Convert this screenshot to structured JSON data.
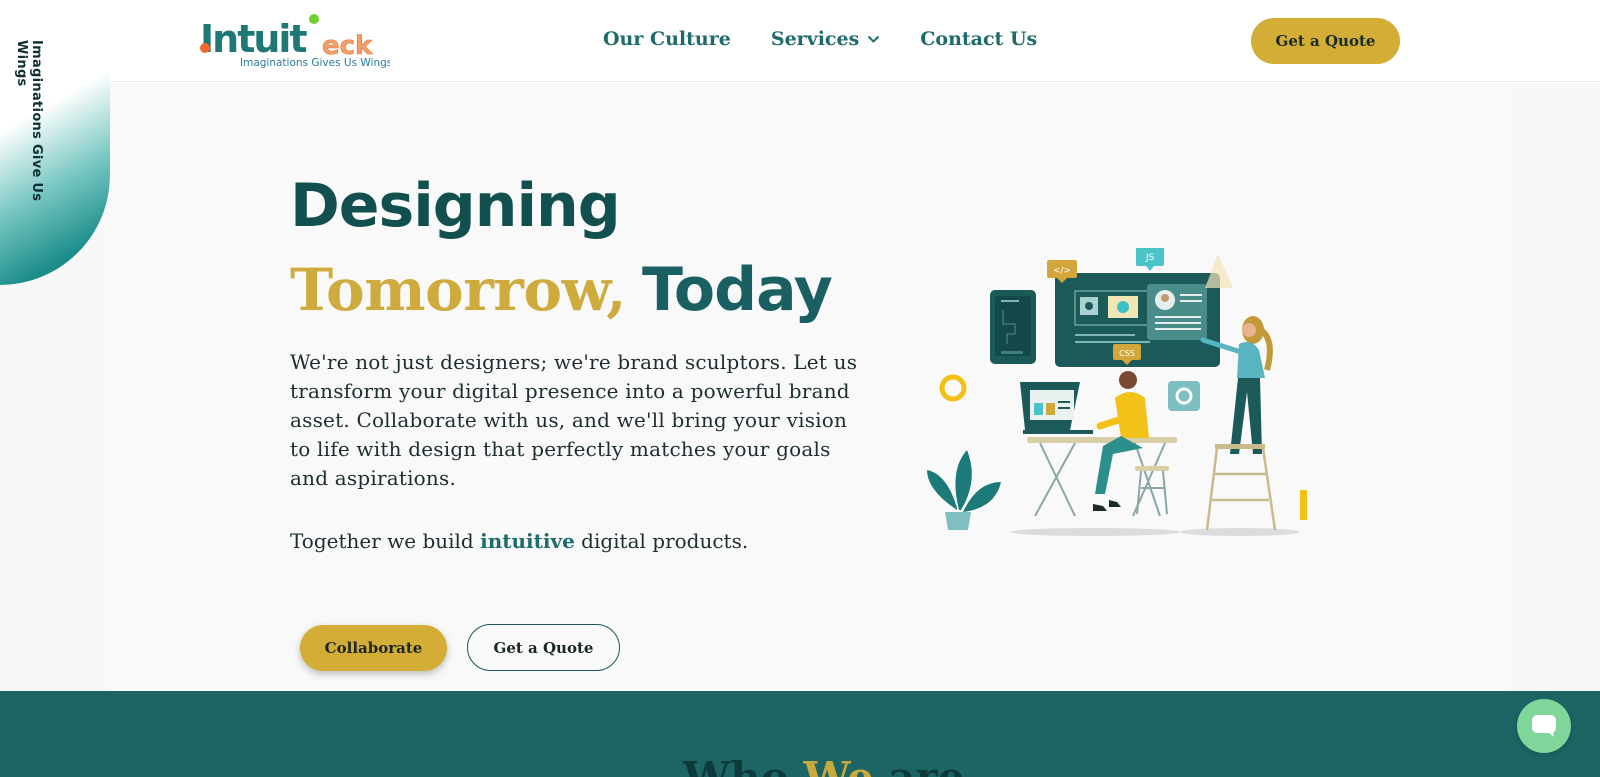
{
  "brand": {
    "logo_text": "Intuit",
    "logo_suffix": "eck",
    "logo_tagline": "Imaginations Gives Us Wings",
    "colors": {
      "teal": "#1d6565",
      "gold": "#d4ad36",
      "orange": "#f06a2a",
      "green_dot": "#6ecf2e"
    }
  },
  "header": {
    "nav": [
      {
        "label": "Our Culture"
      },
      {
        "label": "Services"
      },
      {
        "label": "Contact Us"
      }
    ],
    "cta_label": "Get a Quote"
  },
  "side_tab": {
    "text": "Imaginations Give Us Wings"
  },
  "hero": {
    "headline_line1": "Designing",
    "headline_line2_gold": "Tomorrow,",
    "headline_line2_teal": "Today",
    "paragraph": "We're not just designers; we're brand sculptors. Let us transform your digital presence into a powerful brand asset. Collaborate with us, and we'll bring your vision to life with design that perfectly matches your goals and aspirations.",
    "tagline_pre": "Together we build ",
    "tagline_em": "intuitive",
    "tagline_post": " digital products.",
    "collaborate_label": "Collaborate",
    "quote_label": "Get a Quote",
    "illustration_labels": {
      "code": "</>",
      "js": "JS",
      "css": "CSS"
    }
  },
  "section2": {
    "title_pre": "Who ",
    "title_gold": "We",
    "title_post": " are"
  },
  "chat": {
    "icon": "chat-bubble-icon"
  }
}
